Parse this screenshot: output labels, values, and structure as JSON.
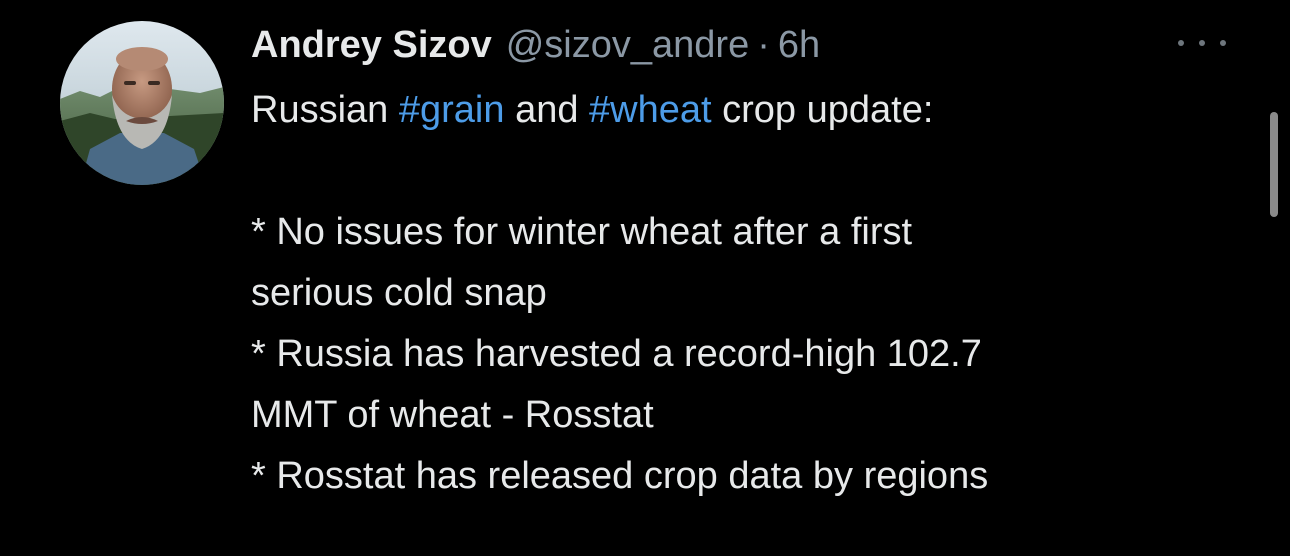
{
  "tweet": {
    "author": {
      "display_name": "Andrey Sizov",
      "handle": "@sizov_andre",
      "separator": "·",
      "time": "6h"
    },
    "more_icon": "more-horizontal-icon",
    "text": {
      "line1_before": "Russian",
      "hashtag1": "#grain",
      "line1_middle": "and",
      "hashtag2": "#wheat",
      "line1_after": "crop update:",
      "line3": "* No issues for winter wheat after a first",
      "line4": "serious cold snap",
      "line5": "* Russia has harvested a record-high 102.7",
      "line6": "MMT of wheat - Rosstat",
      "line7": "* Rosstat has released crop data by regions"
    }
  },
  "colors": {
    "background": "#000000",
    "text": "#e7e9ea",
    "secondary": "#8b98a5",
    "hashtag": "#4d9ce8",
    "scrollbar": "#8a8a8a"
  }
}
